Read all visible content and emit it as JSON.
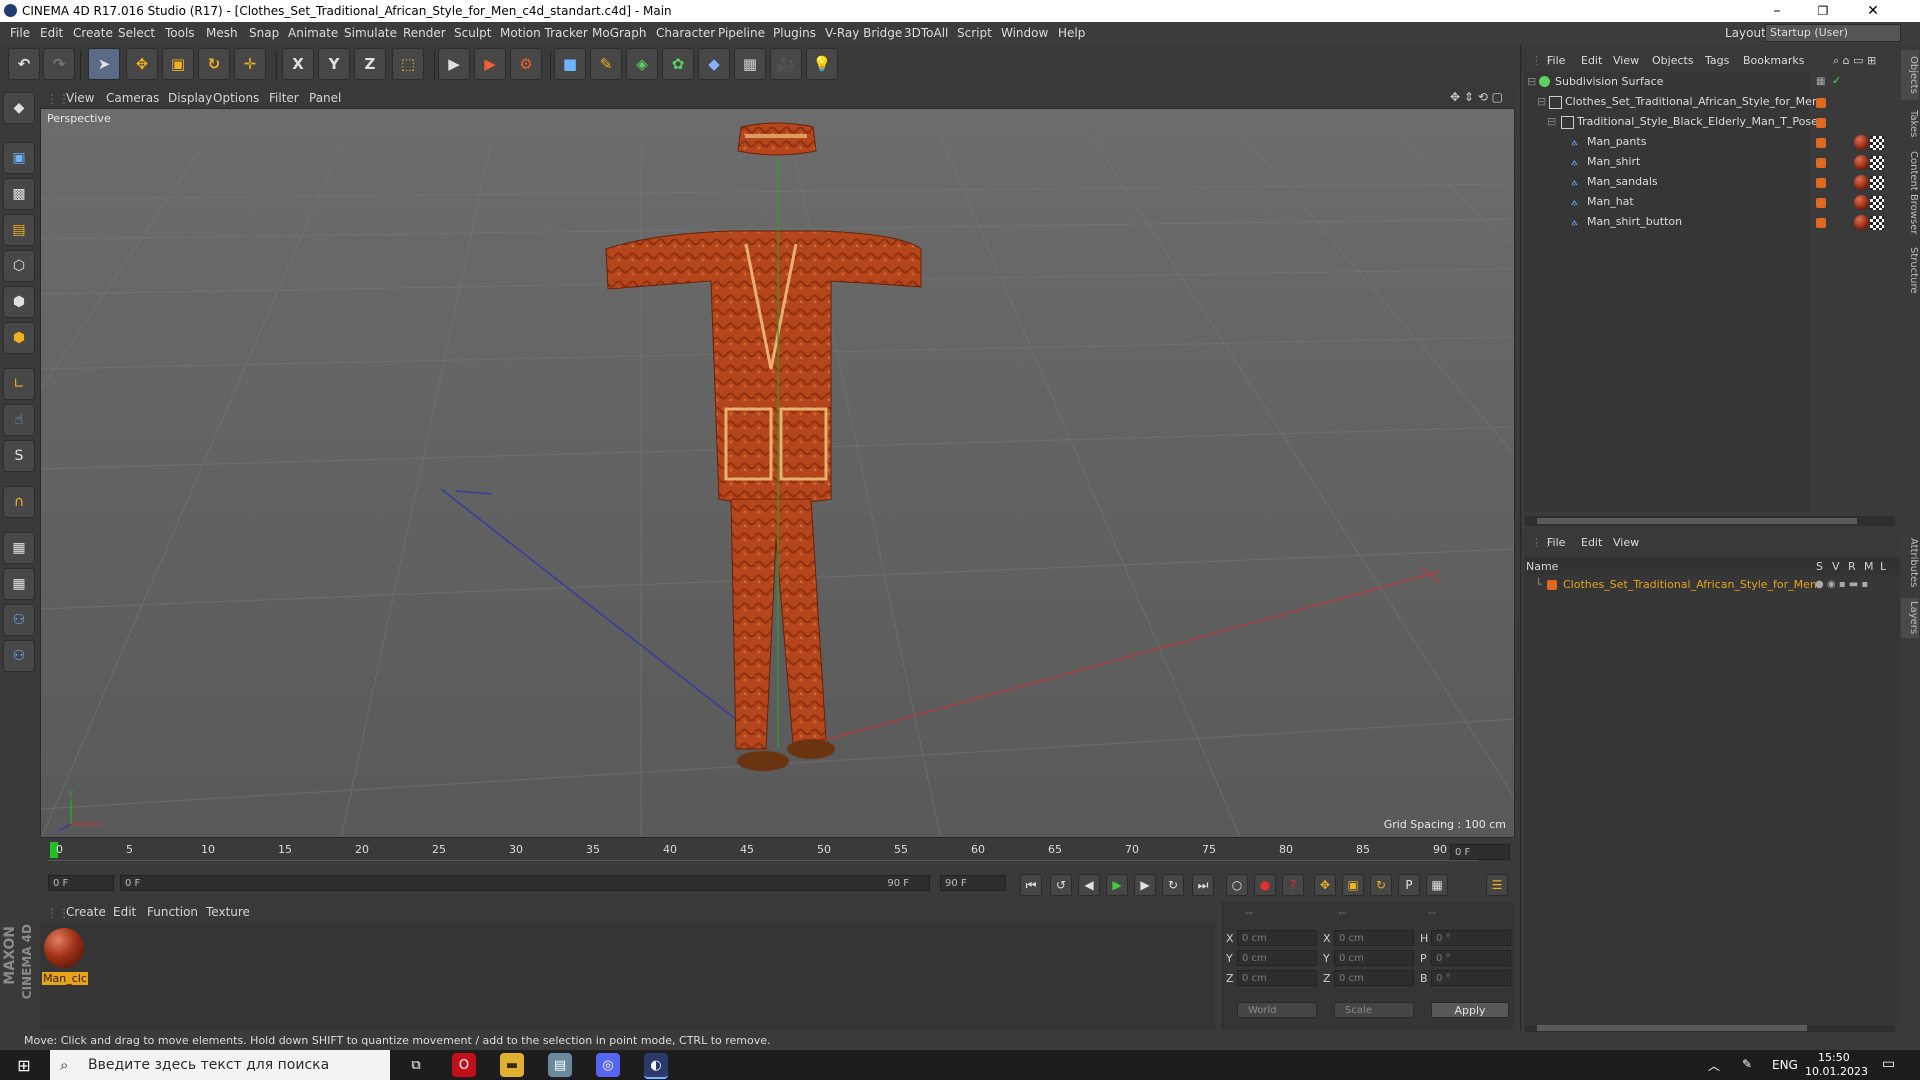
{
  "window": {
    "title": "CINEMA 4D R17.016 Studio (R17) - [Clothes_Set_Traditional_African_Style_for_Men_c4d_standart.c4d] - Main",
    "minimize": "–",
    "maximize": "❐",
    "close": "✕"
  },
  "menubar": {
    "items": [
      "File",
      "Edit",
      "Create",
      "Select",
      "Tools",
      "Mesh",
      "Snap",
      "Animate",
      "Simulate",
      "Render",
      "Sculpt",
      "Motion Tracker",
      "MoGraph",
      "Character",
      "Pipeline",
      "Plugins",
      "V-Ray Bridge",
      "3DToAll",
      "Script",
      "Window",
      "Help"
    ],
    "layout_label": "Layout:",
    "layout_value": "Startup (User)"
  },
  "toolbar": {
    "undo": "↶",
    "redo": "↷",
    "live_select": "➤",
    "move": "✥",
    "scale": "▣",
    "rotate": "↻",
    "transform": "✛",
    "x_axis": "X",
    "y_axis": "Y",
    "z_axis": "Z",
    "coord_system": "⬚",
    "render_view": "▶",
    "render_pic": "▶",
    "render_settings": "⚙",
    "cube": "■",
    "pen": "✎",
    "subdiv": "◈",
    "array": "✿",
    "deformer": "◆",
    "floor": "▦",
    "camera": "🎥",
    "light": "💡"
  },
  "viewport": {
    "menu": [
      "View",
      "Cameras",
      "Display",
      "Options",
      "Filter",
      "Panel"
    ],
    "label": "Perspective",
    "grid_spacing": "Grid Spacing : 100 cm"
  },
  "timeline": {
    "ticks": [
      "0",
      "5",
      "10",
      "15",
      "20",
      "25",
      "30",
      "35",
      "40",
      "45",
      "50",
      "55",
      "60",
      "65",
      "70",
      "75",
      "80",
      "85",
      "90"
    ],
    "end_field": "0 F"
  },
  "playback": {
    "start": "0 F",
    "range_start": "0 F",
    "range_end": "90 F",
    "end": "90 F"
  },
  "material_manager": {
    "menu": [
      "Create",
      "Edit",
      "Function",
      "Texture"
    ],
    "materials": [
      {
        "name": "Man_clc"
      }
    ]
  },
  "coordinates": {
    "header": [
      "--",
      "--",
      "--"
    ],
    "rows": [
      {
        "axis": "X",
        "pos": "0 cm",
        "axis2": "X",
        "size": "0 cm",
        "rot_label": "H",
        "rot": "0 °"
      },
      {
        "axis": "Y",
        "pos": "0 cm",
        "axis2": "Y",
        "size": "0 cm",
        "rot_label": "P",
        "rot": "0 °"
      },
      {
        "axis": "Z",
        "pos": "0 cm",
        "axis2": "Z",
        "size": "0 cm",
        "rot_label": "B",
        "rot": "0 °"
      }
    ],
    "world_dropdown": "World",
    "scale_dropdown": "Scale",
    "apply": "Apply"
  },
  "status": {
    "text": "Move: Click and drag to move elements. Hold down SHIFT to quantize movement / add to the selection in point mode, CTRL to remove."
  },
  "maxon": {
    "brand": "MAXON",
    "product": "CINEMA 4D"
  },
  "object_manager": {
    "menu": [
      "File",
      "Edit",
      "View",
      "Objects",
      "Tags",
      "Bookmarks"
    ],
    "objects": [
      {
        "name": "Subdivision Surface",
        "level": 0
      },
      {
        "name": "Clothes_Set_Traditional_African_Style_for_Men",
        "level": 1
      },
      {
        "name": "Traditional_Style_Black_Elderly_Man_T_Pose",
        "level": 2
      },
      {
        "name": "Man_pants",
        "level": 3
      },
      {
        "name": "Man_shirt",
        "level": 3
      },
      {
        "name": "Man_sandals",
        "level": 3
      },
      {
        "name": "Man_hat",
        "level": 3
      },
      {
        "name": "Man_shirt_button",
        "level": 3
      }
    ]
  },
  "layer_manager": {
    "menu": [
      "File",
      "Edit",
      "View"
    ],
    "columns": {
      "name": "Name",
      "s": "S",
      "v": "V",
      "r": "R",
      "m": "M",
      "l": "L"
    },
    "layers": [
      {
        "name": "Clothes_Set_Traditional_African_Style_for_Men"
      }
    ]
  },
  "side_tabs": [
    "Objects",
    "Takes",
    "Content Browser",
    "Structure",
    "Attributes",
    "Layers"
  ],
  "taskbar": {
    "search_placeholder": "Введите здесь текст для поиска",
    "lang": "ENG",
    "time": "15:50",
    "date": "10.01.2023"
  },
  "colors": {
    "accent_orange": "#e6a31c",
    "object_text": "#dcdcdc",
    "layer_text": "#e6a31c"
  }
}
